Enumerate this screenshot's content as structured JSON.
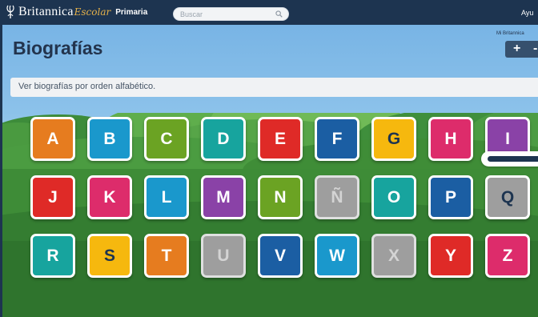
{
  "header": {
    "logo_brand": "Britannica",
    "logo_product": "Escolar",
    "level": "Primaria",
    "search_placeholder": "Buscar",
    "help_label": "Ayu"
  },
  "page": {
    "title": "Biografías",
    "my_britannica": "Mi Britannica",
    "zoom_in": "+",
    "zoom_out": "-",
    "subtitle": "Ver biografías por orden alfabético."
  },
  "letters": [
    {
      "letter": "A",
      "color": "#e67c1f",
      "enabled": true
    },
    {
      "letter": "B",
      "color": "#1a98cc",
      "enabled": true
    },
    {
      "letter": "C",
      "color": "#6ba323",
      "enabled": true
    },
    {
      "letter": "D",
      "color": "#17a49e",
      "enabled": true
    },
    {
      "letter": "E",
      "color": "#df2a27",
      "enabled": true
    },
    {
      "letter": "F",
      "color": "#1b5ea3",
      "enabled": true
    },
    {
      "letter": "G",
      "color": "#f6b80e",
      "enabled": true
    },
    {
      "letter": "H",
      "color": "#dd2c6b",
      "enabled": true
    },
    {
      "letter": "I",
      "color": "#8a42a7",
      "enabled": true
    },
    {
      "letter": "J",
      "color": "#df2a27",
      "enabled": true
    },
    {
      "letter": "K",
      "color": "#dd2c6b",
      "enabled": true
    },
    {
      "letter": "L",
      "color": "#1a98cc",
      "enabled": true
    },
    {
      "letter": "M",
      "color": "#8a42a7",
      "enabled": true
    },
    {
      "letter": "N",
      "color": "#6ba323",
      "enabled": true
    },
    {
      "letter": "Ñ",
      "color": "#9e9e9e",
      "enabled": false
    },
    {
      "letter": "O",
      "color": "#17a49e",
      "enabled": true
    },
    {
      "letter": "P",
      "color": "#1b5ea3",
      "enabled": true
    },
    {
      "letter": "Q",
      "color": "#9e9e9e",
      "enabled": true
    },
    {
      "letter": "R",
      "color": "#17a49e",
      "enabled": true
    },
    {
      "letter": "S",
      "color": "#f6b80e",
      "enabled": true
    },
    {
      "letter": "T",
      "color": "#e67c1f",
      "enabled": true
    },
    {
      "letter": "U",
      "color": "#9e9e9e",
      "enabled": false
    },
    {
      "letter": "V",
      "color": "#1b5ea3",
      "enabled": true
    },
    {
      "letter": "W",
      "color": "#1a98cc",
      "enabled": true
    },
    {
      "letter": "X",
      "color": "#9e9e9e",
      "enabled": false
    },
    {
      "letter": "Y",
      "color": "#df2a27",
      "enabled": true
    },
    {
      "letter": "Z",
      "color": "#dd2c6b",
      "enabled": true
    }
  ],
  "icons": {
    "logo": "thistle-icon",
    "search": "search-icon"
  },
  "colors": {
    "header_bg": "#1d3450",
    "title": "#23344d",
    "accent_logo": "#e6b24a"
  }
}
